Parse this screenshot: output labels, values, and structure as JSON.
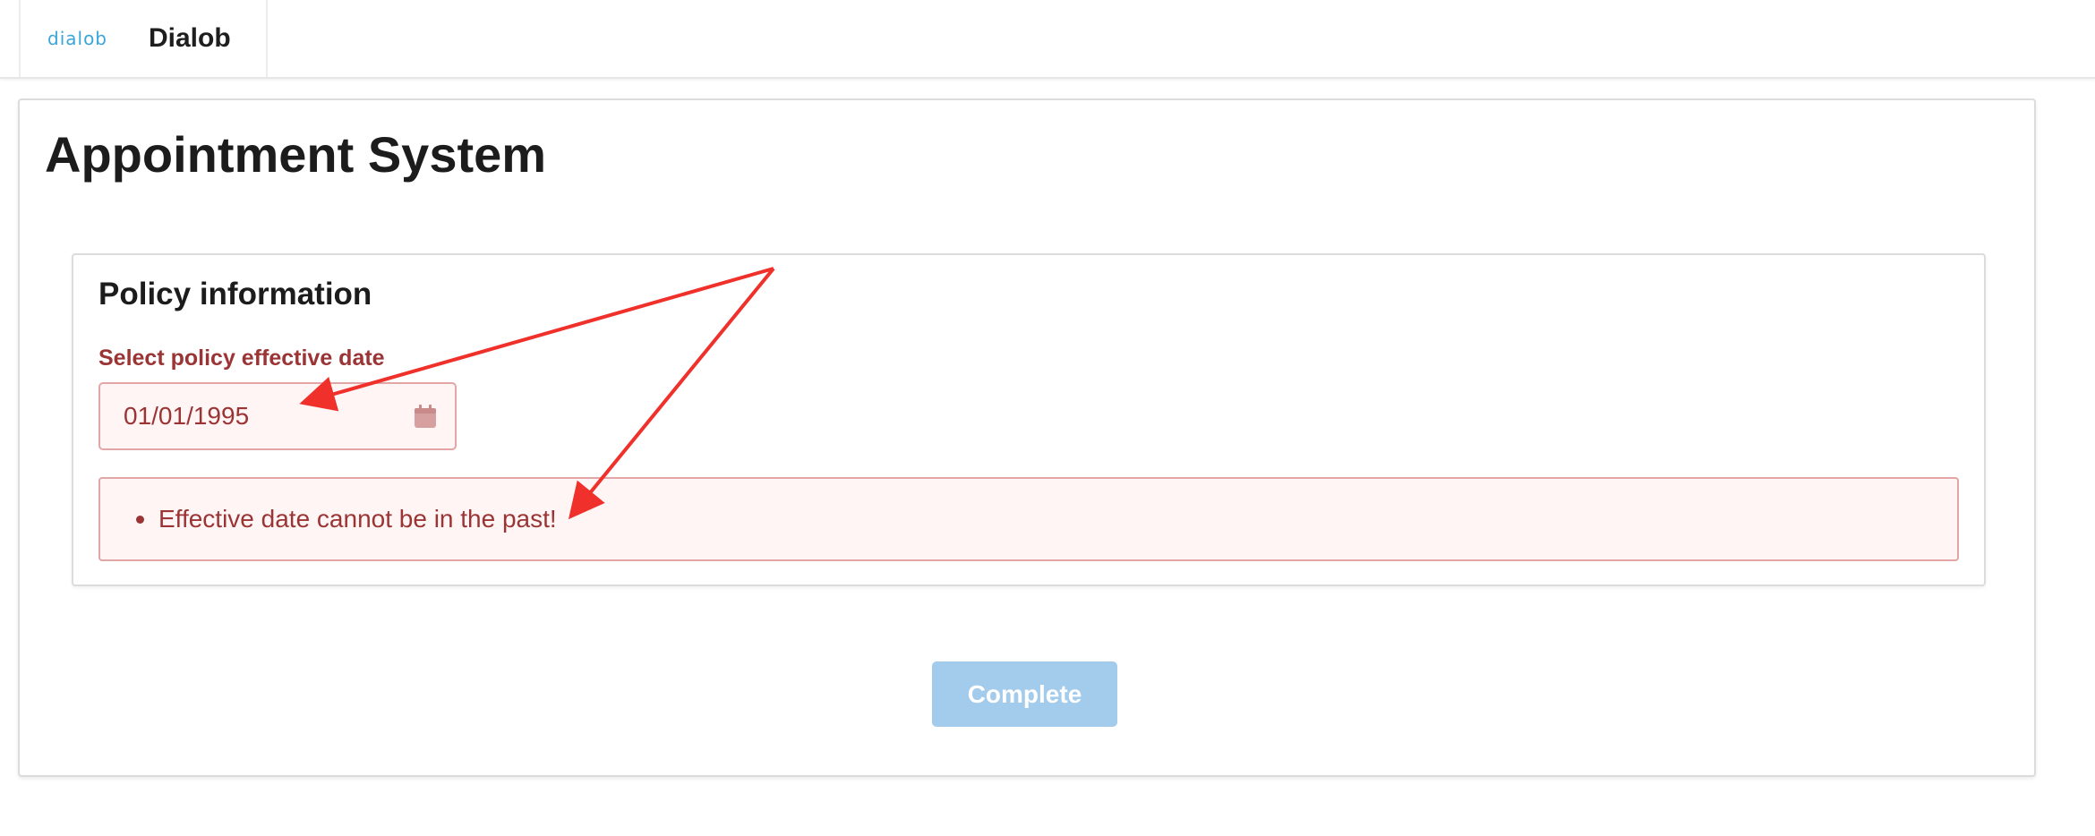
{
  "header": {
    "logo_text": "dialob",
    "app_name": "Dialob"
  },
  "page": {
    "title": "Appointment System"
  },
  "group": {
    "title": "Policy information",
    "field": {
      "label": "Select policy effective date",
      "value": "01/01/1995",
      "icon": "calendar-icon"
    },
    "errors": [
      "Effective date cannot be in the past!"
    ]
  },
  "actions": {
    "complete_label": "Complete"
  },
  "colors": {
    "error": "#9b3434",
    "error_background": "#fff5f5",
    "error_border": "#e2a6a6",
    "button_disabled": "#a3cbec",
    "annotation_arrow": "#f0302a",
    "logo": "#3aa6d8"
  }
}
